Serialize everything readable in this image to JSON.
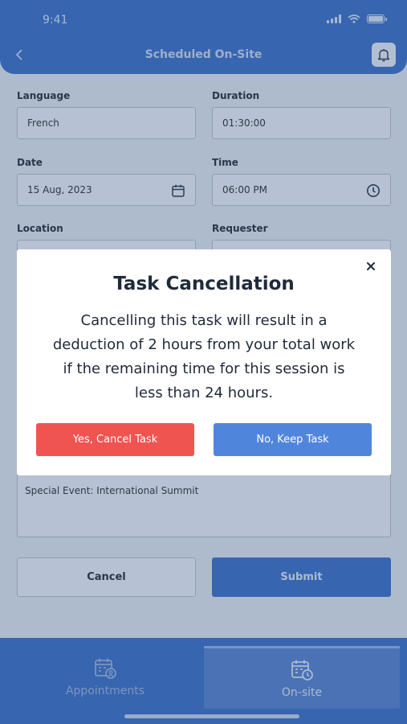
{
  "status_bar": {
    "time": "9:41"
  },
  "header": {
    "title": "Scheduled On-Site"
  },
  "form": {
    "language": {
      "label": "Language",
      "value": "French"
    },
    "duration": {
      "label": "Duration",
      "value": "01:30:00"
    },
    "date": {
      "label": "Date",
      "value": "15 Aug, 2023"
    },
    "time": {
      "label": "Time",
      "value": "06:00 PM"
    },
    "location": {
      "label": "Location"
    },
    "requester": {
      "label": "Requester"
    },
    "notes": {
      "value": "Special Event: International Summit"
    },
    "cancel_label": "Cancel",
    "submit_label": "Submit"
  },
  "bottom_nav": {
    "items": [
      {
        "label": "Appointments",
        "icon": "calendar-user-icon"
      },
      {
        "label": "On-site",
        "icon": "calendar-clock-icon",
        "active": true
      }
    ]
  },
  "modal": {
    "title": "Task Cancellation",
    "body": "Cancelling this task will result in a deduction of 2 hours from your total work if the remaining time for this session is less than 24 hours.",
    "confirm_label": "Yes, Cancel Task",
    "dismiss_label": "No, Keep Task"
  },
  "colors": {
    "primary": "#3f71c6",
    "danger": "#f05451",
    "secondary_button": "#4f86dc"
  }
}
